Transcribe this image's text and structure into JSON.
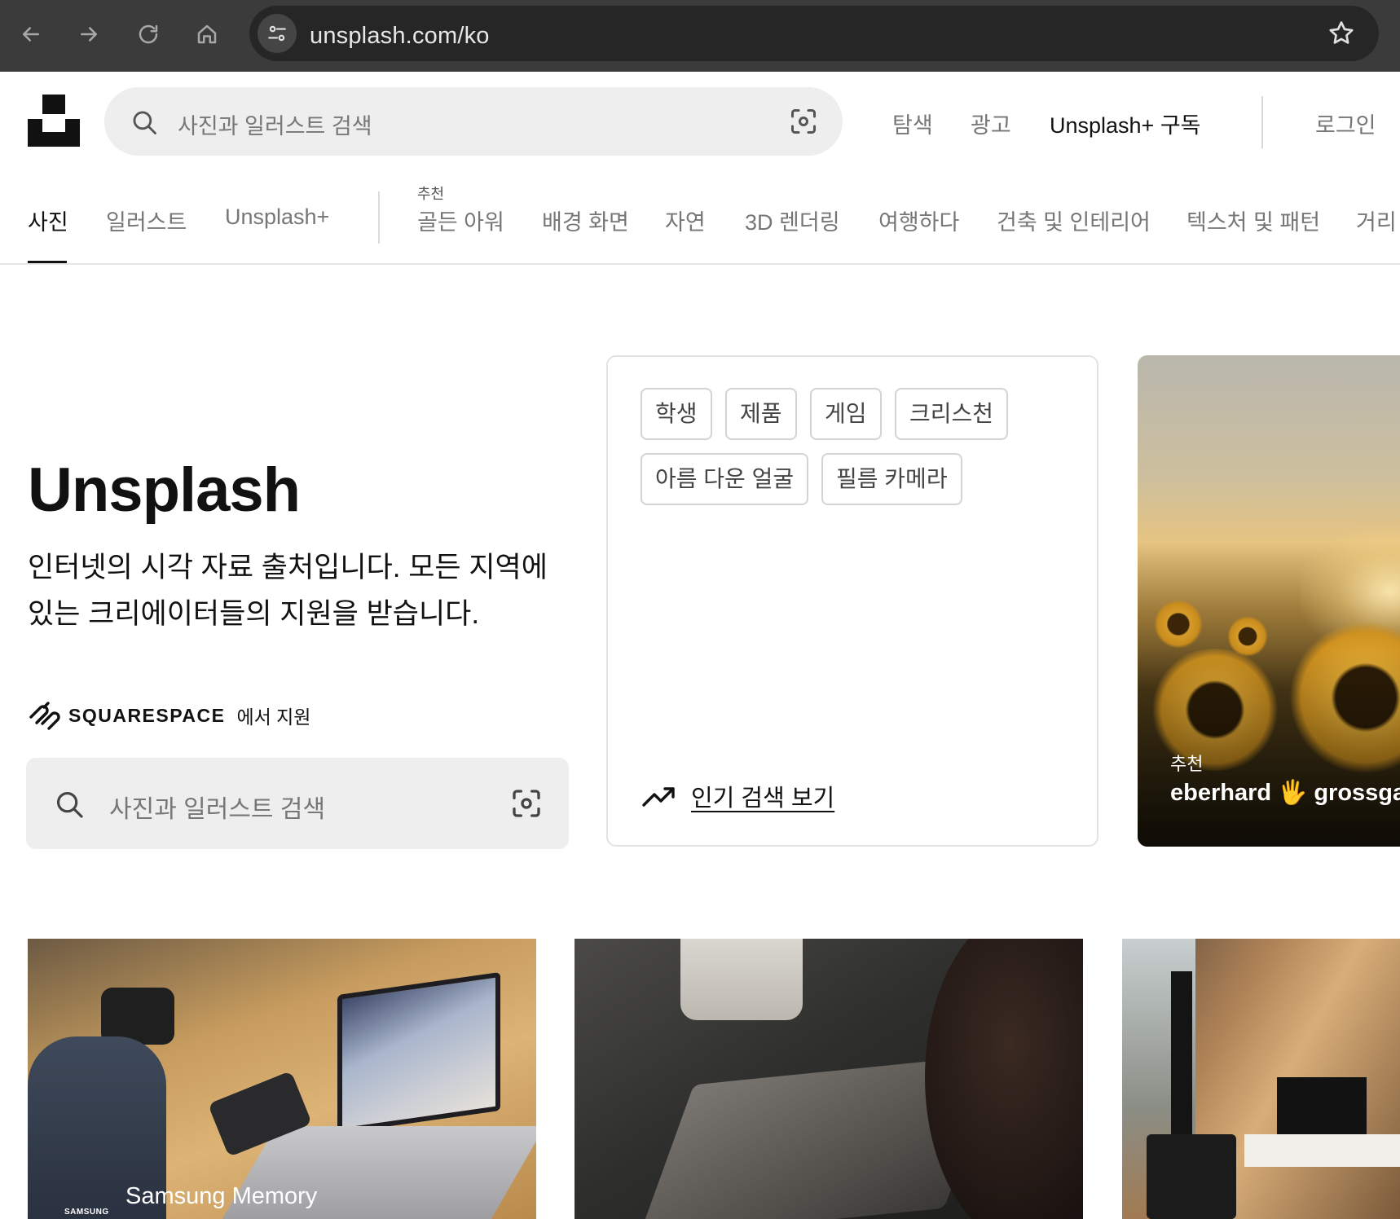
{
  "browser": {
    "url": "unsplash.com/ko"
  },
  "header": {
    "search_placeholder": "사진과 일러스트 검색",
    "links": {
      "explore": "탐색",
      "advertise": "광고",
      "plus": "Unsplash+ 구독",
      "login": "로그인"
    }
  },
  "tabs": {
    "items": [
      "사진",
      "일러스트",
      "Unsplash+"
    ],
    "featured_kicker": "추천",
    "topics": [
      "골든 아워",
      "배경 화면",
      "자연",
      "3D 렌더링",
      "여행하다",
      "건축 및 인테리어",
      "텍스처 및 패턴",
      "거리"
    ]
  },
  "hero": {
    "title": "Unsplash",
    "subtitle": "인터넷의 시각 자료 출처입니다. 모든 지역에 있는 크리에이터들의 지원을 받습니다.",
    "sponsor_name": "SQUARESPACE",
    "sponsor_suffix": "에서 지원",
    "search_placeholder": "사진과 일러스트 검색"
  },
  "trending": {
    "chips": [
      "학생",
      "제품",
      "게임",
      "크리스천",
      "아름 다운 얼굴",
      "필름 카메라"
    ],
    "link": "인기 검색 보기"
  },
  "featured": {
    "kicker": "추천",
    "author": "eberhard 🖐 grossgasteiger"
  },
  "grid": {
    "photo1_label": "Samsung Memory",
    "photo1_brand": "SAMSUNG"
  }
}
